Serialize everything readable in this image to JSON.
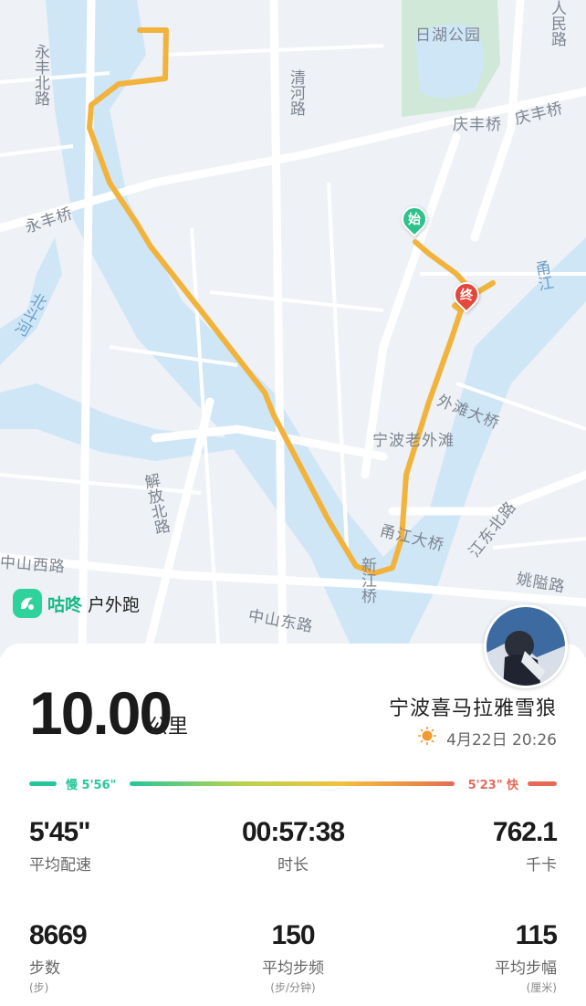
{
  "map": {
    "labels": {
      "rihu_park": "日湖公园",
      "renmin_road": "人民路",
      "yongbei_road": "永丰北路",
      "qinghe_road": "清河路",
      "qingfeng_bridge_1": "庆丰桥",
      "qingfeng_bridge_2": "庆丰桥",
      "yongfeng_bridge": "永丰桥",
      "beidou_river": "北斗河",
      "yong_river": "甬江",
      "waitan_bridge": "外滩大桥",
      "ningbo_waitan": "宁波老外滩",
      "jiefang_road": "解放北路",
      "yongjiang_bridge": "甬江大桥",
      "jiangdong_road": "江东北路",
      "zhongshan_west": "中山西路",
      "xinjiang_bridge": "新江桥",
      "zhongshan_east": "中山东路",
      "yaoai_road": "姚隘路"
    },
    "start_marker": "始",
    "end_marker": "终"
  },
  "brand": {
    "name_part1": "咕咚",
    "name_part2": "户外跑",
    "icon": "gudong-logo-icon"
  },
  "run": {
    "distance": "10.00",
    "distance_unit": "公里",
    "user": "宁波喜马拉雅雪狼",
    "weather_icon": "sun-icon",
    "datetime": "4月22日 20:26"
  },
  "pace_bar": {
    "slow_label": "慢 5'56\"",
    "fast_label": "5'23\" 快",
    "slow_color": "#27c69a",
    "fast_color": "#e46a58"
  },
  "stats": {
    "avg_pace": {
      "value": "5'45\"",
      "label": "平均配速"
    },
    "duration": {
      "value": "00:57:38",
      "label": "时长"
    },
    "calories": {
      "value": "762.1",
      "label": "千卡"
    },
    "steps": {
      "value": "8669",
      "label": "步数",
      "unit": "(步)"
    },
    "cadence": {
      "value": "150",
      "label": "平均步频",
      "unit": "(步/分钟)"
    },
    "stride": {
      "value": "115",
      "label": "平均步幅",
      "unit": "(厘米)"
    }
  },
  "colors": {
    "route": "#f2b33d",
    "river": "#cfe6f7",
    "accent": "#17b985"
  }
}
